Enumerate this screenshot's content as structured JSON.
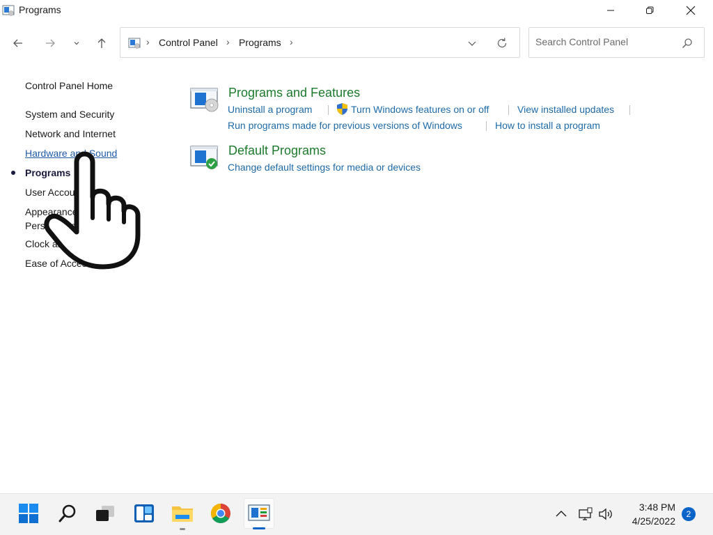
{
  "window": {
    "title": "Programs",
    "icon": "control-panel-programs-icon"
  },
  "nav": {
    "breadcrumb": [
      "Control Panel",
      "Programs"
    ],
    "search_placeholder": "Search Control Panel"
  },
  "sidebar": {
    "items": [
      {
        "label": "Control Panel Home",
        "state": "normal"
      },
      {
        "label": "System and Security",
        "state": "normal"
      },
      {
        "label": "Network and Internet",
        "state": "normal"
      },
      {
        "label": "Hardware and Sound",
        "state": "hover-link"
      },
      {
        "label": "Programs",
        "state": "current"
      },
      {
        "label": "User Accounts",
        "state": "normal"
      },
      {
        "label": "Appearance and",
        "state": "normal"
      },
      {
        "label": "Personalization",
        "state": "normal"
      },
      {
        "label": "Clock and Region",
        "state": "normal"
      },
      {
        "label": "Ease of Access",
        "state": "normal"
      }
    ]
  },
  "categories": [
    {
      "title": "Programs and Features",
      "links": [
        "Uninstall a program",
        "Turn Windows features on or off",
        "View installed updates",
        "Run programs made for previous versions of Windows",
        "How to install a program"
      ]
    },
    {
      "title": "Default Programs",
      "links": [
        "Change default settings for media or devices"
      ]
    }
  ],
  "taskbar": {
    "apps": [
      "start-button",
      "search-button",
      "task-view-button",
      "widgets-button",
      "file-explorer",
      "chrome",
      "control-panel"
    ],
    "time": "3:48 PM",
    "date": "4/25/2022",
    "notifications": "2"
  },
  "colors": {
    "link": "#1e6aa8",
    "category_title": "#1b7a2c",
    "accent": "#0a63c9"
  }
}
